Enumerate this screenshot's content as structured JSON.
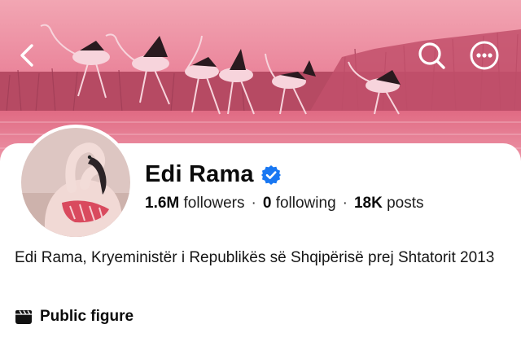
{
  "profile": {
    "name": "Edi Rama",
    "verified": true,
    "followers_count": "1.6M",
    "followers_label": "followers",
    "following_count": "0",
    "following_label": "following",
    "posts_count": "18K",
    "posts_label": "posts",
    "separator": "·",
    "bio": "Edi Rama, Kryeministër i Republikës së Shqipërisë prej Shtatorit 2013",
    "category": "Public figure"
  },
  "icons": {
    "back": "chevron-left-icon",
    "search": "search-icon",
    "more": "more-horizontal-icon",
    "verified": "verified-badge-icon",
    "category": "clapperboard-icon"
  },
  "colors": {
    "verified_blue": "#1877f2",
    "cover_tint": "#d9546f",
    "text": "#111111"
  }
}
